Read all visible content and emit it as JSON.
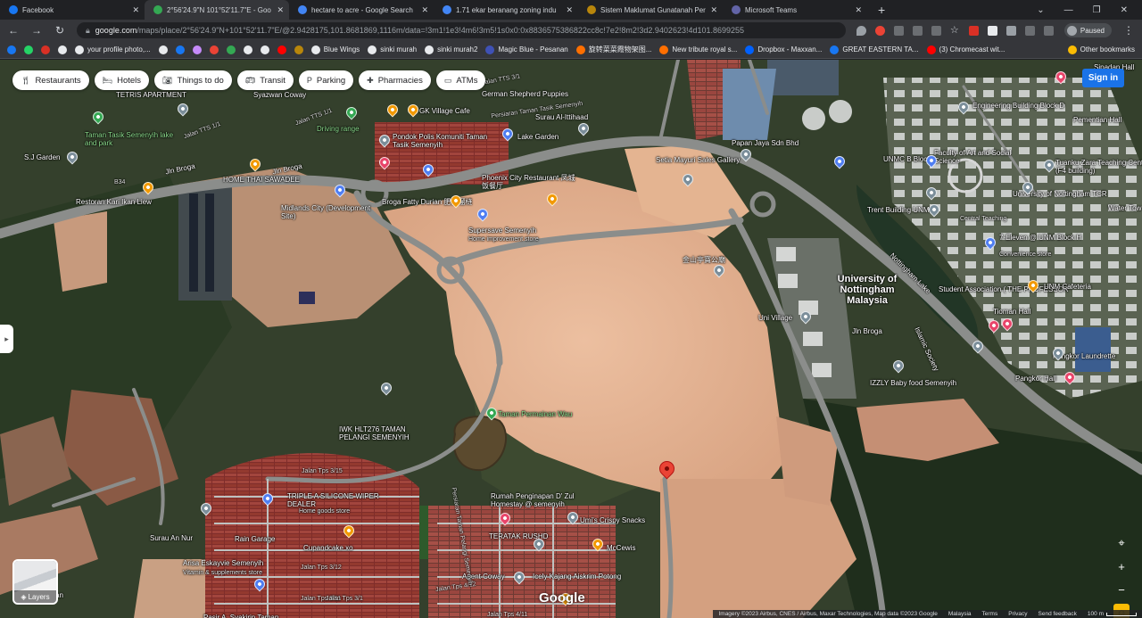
{
  "browser": {
    "tabs": [
      {
        "title": "Facebook",
        "icon": "facebook-icon",
        "color": "#1877f2",
        "active": false
      },
      {
        "title": "2°56'24.9\"N 101°52'11.7\"E - Goo",
        "icon": "google-maps-icon",
        "color": "#34a853",
        "active": true
      },
      {
        "title": "hectare to acre - Google Search",
        "icon": "google-icon",
        "color": "#4285f4",
        "active": false
      },
      {
        "title": "1.71 ekar beranang zoning indu",
        "icon": "google-icon",
        "color": "#4285f4",
        "active": false
      },
      {
        "title": "Sistem Maklumat Gunatanah Per",
        "icon": "gov-crest-icon",
        "color": "#b8860b",
        "active": false
      },
      {
        "title": "Microsoft Teams",
        "icon": "teams-icon",
        "color": "#6264a7",
        "active": false
      }
    ],
    "new_tab": "+",
    "url_host": "google.com",
    "url_path": "/maps/place/2°56'24.9\"N+101°52'11.7\"E/@2.9428175,101.8681869,1116m/data=!3m1!1e3!4m6!3m5!1s0x0:0x8836575386822cc8c!7e2!8m2!3d2.9402623!4d101.8699255",
    "profile": "Paused",
    "bookmarks": [
      {
        "label": "",
        "color": "#1877f2"
      },
      {
        "label": "",
        "color": "#25d366"
      },
      {
        "label": "",
        "color": "#d93025"
      },
      {
        "label": "",
        "color": "#e8eaed"
      },
      {
        "label": "your profile photo,...",
        "color": "#e8eaed"
      },
      {
        "label": "",
        "color": "#e8eaed"
      },
      {
        "label": "",
        "color": "#1877f2"
      },
      {
        "label": "",
        "color": "#c58af9"
      },
      {
        "label": "",
        "color": "#ea4335"
      },
      {
        "label": "",
        "color": "#34a853"
      },
      {
        "label": "",
        "color": "#e8eaed"
      },
      {
        "label": "",
        "color": "#e8eaed"
      },
      {
        "label": "",
        "color": "#ff0000"
      },
      {
        "label": "",
        "color": "#b8860b"
      },
      {
        "label": "Blue Wings",
        "color": "#e8eaed"
      },
      {
        "label": "sinki murah",
        "color": "#e8eaed"
      },
      {
        "label": "sinki murah2",
        "color": "#e8eaed"
      },
      {
        "label": "Magic Blue - Pesanan",
        "color": "#3f51b5"
      },
      {
        "label": "旋转菜菜霞物架图...",
        "color": "#ff6f00"
      },
      {
        "label": "New tribute royal s...",
        "color": "#ff6f00"
      },
      {
        "label": "Dropbox - Maxxan...",
        "color": "#0061ff"
      },
      {
        "label": "GREAT EASTERN TA...",
        "color": "#1877f2"
      },
      {
        "label": "(3) Chromecast wit...",
        "color": "#ff0000"
      },
      {
        "label": "Other bookmarks",
        "color": "#fbbc04"
      }
    ]
  },
  "map": {
    "chips": [
      {
        "label": "Restaurants",
        "icon": "fork-knife-icon"
      },
      {
        "label": "Hotels",
        "icon": "bed-icon"
      },
      {
        "label": "Things to do",
        "icon": "camera-icon"
      },
      {
        "label": "Transit",
        "icon": "bus-icon"
      },
      {
        "label": "Parking",
        "icon": "parking-icon"
      },
      {
        "label": "Pharmacies",
        "icon": "pharmacy-icon"
      },
      {
        "label": "ATMs",
        "icon": "atm-icon"
      }
    ],
    "sign_in": "Sign in",
    "layers_label": "Layers",
    "logo": "Google",
    "attribution": [
      "Imagery ©2023 Airbus, CNES / Airbus, Maxar Technologies, Map data ©2023 Google",
      "Malaysia",
      "Terms",
      "Privacy",
      "Send feedback"
    ],
    "scale_label": "100 m",
    "pin_colors": {
      "red": "#ea4335",
      "blue": "#4f7ef2",
      "orange": "#f29900",
      "pink": "#e8446a",
      "green": "#34a853",
      "grey": "#7b8e9a"
    },
    "labels": [
      {
        "text": "TETRIS APARTMENT",
        "cls": ""
      },
      {
        "text": "Syazwan Coway",
        "cls": ""
      },
      {
        "text": "Taman Tasik Semenyih lake and park",
        "cls": "grn"
      },
      {
        "text": "Jalan TTS 1/1",
        "cls": "rd"
      },
      {
        "text": "Jalan TTS 1/1",
        "cls": "rd"
      },
      {
        "text": "Driving range",
        "cls": "grn"
      },
      {
        "text": "S.J Garden",
        "cls": ""
      },
      {
        "text": "Jln Broga",
        "cls": ""
      },
      {
        "text": "Jln Broga",
        "cls": ""
      },
      {
        "text": "HOME THAI SAWADEE",
        "cls": ""
      },
      {
        "text": "Restoran Kari Ikan Liew",
        "cls": ""
      },
      {
        "text": "Midlands City (Development Site)",
        "cls": ""
      },
      {
        "text": "Jalan TTS 3/1",
        "cls": "rd"
      },
      {
        "text": "German Shepherd Puppies",
        "cls": ""
      },
      {
        "text": "Persiaran Taman Tasik Semenyih",
        "cls": "rd"
      },
      {
        "text": "GK Village Cafe",
        "cls": ""
      },
      {
        "text": "Surau Al-Ittihaad",
        "cls": ""
      },
      {
        "text": "Pondok Polis Komuniti Taman Tasik Semenyih",
        "cls": ""
      },
      {
        "text": "Lake Garden",
        "cls": ""
      },
      {
        "text": "Phoenix City Restaurant 凤城饭餐厅",
        "cls": ""
      },
      {
        "text": "Broga Fatty Durian 肥仔榴梿",
        "cls": ""
      },
      {
        "text": "Supersave Semenyih",
        "cls": ""
      },
      {
        "text": "Home improvement store",
        "cls": "sub"
      },
      {
        "text": "Papan Jaya Sdn Bhd",
        "cls": ""
      },
      {
        "text": "Setia Mayuri Sales Gallery",
        "cls": ""
      },
      {
        "text": "金山亭寶公廟",
        "cls": ""
      },
      {
        "text": "Uni Village",
        "cls": ""
      },
      {
        "text": "Taman Permainan Wau",
        "cls": "grn"
      },
      {
        "text": "IWK HLT276 TAMAN PELANGI SEMENYIH",
        "cls": ""
      },
      {
        "text": "Jalan Tps 3/15",
        "cls": "rd"
      },
      {
        "text": "TRIPLE A SILICONE WIPER DEALER",
        "cls": ""
      },
      {
        "text": "Home goods store",
        "cls": "sub"
      },
      {
        "text": "Surau An Nur",
        "cls": ""
      },
      {
        "text": "Rain Garage",
        "cls": ""
      },
      {
        "text": "Cupandcake.xo",
        "cls": ""
      },
      {
        "text": "Jalan Tps 3/12",
        "cls": "rd"
      },
      {
        "text": "Arisa Eskayvie Semenyih",
        "cls": ""
      },
      {
        "text": "Vitamin & supplements store",
        "cls": "sub"
      },
      {
        "text": "Jalan Tps 3/11",
        "cls": "rd"
      },
      {
        "text": "Rumah Penginapan D' Zul Homestay @ semenyih",
        "cls": ""
      },
      {
        "text": "Umi's Crispy Snacks",
        "cls": ""
      },
      {
        "text": "TERATAK RUSHD",
        "cls": ""
      },
      {
        "text": "McCewis",
        "cls": ""
      },
      {
        "text": "Agent Coway",
        "cls": ""
      },
      {
        "text": "Jalan Tps 4/12",
        "cls": "rd"
      },
      {
        "text": "Icely Kajang Aiskrim Potong",
        "cls": ""
      },
      {
        "text": "Persiaran Taman Pelangi Semenyih",
        "cls": "rd"
      },
      {
        "text": "University of Nottingham Malaysia",
        "cls": "big"
      },
      {
        "text": "Nottingham Lake",
        "cls": ""
      },
      {
        "text": "Engineering Building Block D",
        "cls": ""
      },
      {
        "text": "UNMC B Block",
        "cls": ""
      },
      {
        "text": "Faculty of Art and Social Science",
        "cls": ""
      },
      {
        "text": "Tuanku Zara Teaching Centre (F4 building)",
        "cls": ""
      },
      {
        "text": "University of Nottingham TCR",
        "cls": ""
      },
      {
        "text": "Trent Building UNMC",
        "cls": ""
      },
      {
        "text": "Central Teaching",
        "cls": "rd"
      },
      {
        "text": "7-Eleven @ UNM Block H",
        "cls": ""
      },
      {
        "text": "Convenience store",
        "cls": "sub"
      },
      {
        "text": "Student Association ( THE PROFESSOR",
        "cls": ""
      },
      {
        "text": "UNM Cafeteria",
        "cls": ""
      },
      {
        "text": "Tioman Hall",
        "cls": ""
      },
      {
        "text": "Islamic Society",
        "cls": ""
      },
      {
        "text": "Jln Broga",
        "cls": ""
      },
      {
        "text": "Pangkor Laundrette",
        "cls": ""
      },
      {
        "text": "Pangkor Hall",
        "cls": ""
      },
      {
        "text": "IZZLY Baby food Semenyih",
        "cls": ""
      },
      {
        "text": "Pementian Hall",
        "cls": ""
      },
      {
        "text": "Sipadan Hall",
        "cls": ""
      },
      {
        "text": "Water Tow",
        "cls": ""
      },
      {
        "text": "B34",
        "cls": "rd"
      },
      {
        "text": "Pasir A. Syakirin Taman",
        "cls": ""
      },
      {
        "text": "Jalan Tps 4/11",
        "cls": "rd"
      },
      {
        "text": "Jalan Tps 3/1",
        "cls": "rd"
      },
      {
        "text": "Kutan",
        "cls": ""
      }
    ]
  }
}
